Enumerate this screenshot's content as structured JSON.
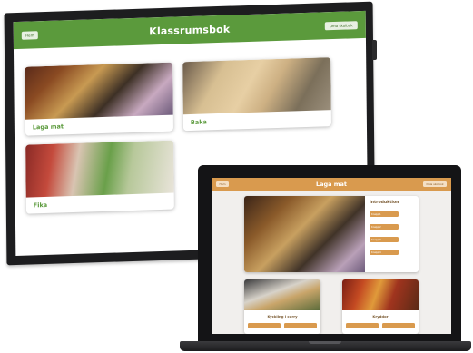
{
  "tv": {
    "header": {
      "title": "Klassrumsbok",
      "left_button": "Hem",
      "right_button": "Dela skolbok"
    },
    "cards": [
      {
        "label": "Laga mat",
        "photo": "food-plate-photo"
      },
      {
        "label": "Baka",
        "photo": "bread-rolls-photo"
      },
      {
        "label": "Fika",
        "photo": "phone-food-photo"
      }
    ],
    "colors": {
      "accent": "#5b9a3c"
    }
  },
  "laptop": {
    "header": {
      "title": "Laga mat",
      "left_button": "Hem",
      "right_button": "Dela skolbok"
    },
    "main_card": {
      "title": "Introduktion",
      "buttons": [
        "Knapp 1",
        "Knapp 2",
        "Knapp 3",
        "Knapp 4"
      ]
    },
    "sub_cards": [
      {
        "label": "Kyckling i curry"
      },
      {
        "label": "Kryddor"
      }
    ],
    "colors": {
      "accent": "#d99a4e"
    }
  }
}
